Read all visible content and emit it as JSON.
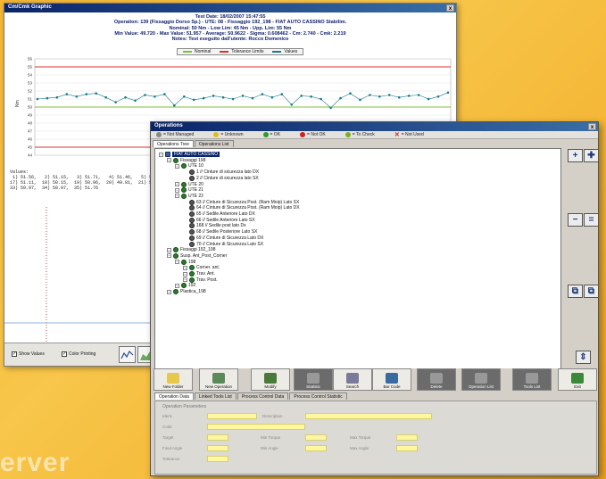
{
  "graph_window": {
    "title": "Cm/Cmk Graphic",
    "close": "x",
    "header_lines": [
      "Test Date: 18/02/2007 15:47:55",
      "Operation: 139 (Fissaggio Dorso Sp.)  -  UTE: 08  -  Fissaggio 192_198  -  FIAT AUTO CASSINO Stabilim.",
      "Nominal: 50 Nm  -  Low Lim: 45 Nm  -  Upp. Lim: 55 Nm",
      "Min Value: 49.720  -  Max Value: 51.957  -  Average: 50.9622  -  Sigma: 0.608462  -  Cm: 2.740  -  Cmk: 2.219",
      "Notes: Test eseguito dall'utente: Rocco Domenico"
    ],
    "legend": [
      "Nominal",
      "Tolerance Limits",
      "Values"
    ],
    "y_axis_label": "Nm",
    "values_label": "Values:",
    "values_lines": [
      " 1) 51.56,   2) 51.15,   3) 51.71,   4) 51.46,   5) 51.76,",
      "17) 51.11,  18) 50.15,  19) 50.96,  20) 49.81,  21) 51.14,",
      "33) 50.97,  34) 50.97,  35) 51.76"
    ],
    "footer": {
      "show_values": "Show Values",
      "color_printing": "Color Printing"
    }
  },
  "chart_data": {
    "type": "line",
    "title": "",
    "xlabel": "",
    "ylabel": "Nm",
    "ylim": [
      44,
      56
    ],
    "y_ticks": [
      56,
      55,
      54,
      53,
      52,
      51,
      50,
      49,
      48,
      47,
      46,
      45,
      44
    ],
    "nominal": 50,
    "tolerance_limits": [
      45,
      55
    ],
    "series": [
      {
        "name": "Values",
        "values": [
          51.0,
          51.1,
          51.2,
          51.6,
          51.3,
          51.6,
          51.7,
          51.2,
          50.6,
          51.2,
          50.8,
          51.5,
          51.3,
          51.6,
          50.2,
          51.3,
          50.9,
          51.1,
          51.4,
          51.2,
          51.0,
          51.4,
          51.1,
          51.6,
          51.2,
          51.6,
          50.3,
          51.4,
          51.3,
          51.0,
          49.9,
          51.1,
          51.7,
          50.9,
          51.5,
          51.3,
          51.5,
          51.2,
          51.4,
          51.5,
          51.0,
          51.3,
          51.8
        ]
      }
    ],
    "colors": {
      "nominal": "#7fc23a",
      "limits": "#e03030",
      "values": "#1a7a8a"
    }
  },
  "ops_window": {
    "title": "Operations",
    "close": "x",
    "legend": [
      {
        "label": "= Not Managed",
        "color": "#888888"
      },
      {
        "label": "= Unknown",
        "color": "#d8c020"
      },
      {
        "label": "= OK",
        "color": "#2c9a2c"
      },
      {
        "label": "= Not OK",
        "color": "#d02020"
      },
      {
        "label": "= To Check",
        "color": "#7ab020"
      },
      {
        "label": "= Not Used",
        "color": "#d02020"
      }
    ],
    "tabs": [
      "Operations Tree",
      "Operations List"
    ],
    "tree": [
      {
        "text": "FIAT AUTO CASSINO",
        "level": 0,
        "icon": "doc",
        "selected": true
      },
      {
        "text": "Fissaggi 198",
        "level": 1,
        "icon": "node"
      },
      {
        "text": "UTE 10",
        "level": 2,
        "icon": "node"
      },
      {
        "text": "1 // Cinture di sicurezza lato DX",
        "level": 3,
        "icon": "gear"
      },
      {
        "text": "2 // Cinture di sicurezza lato SX",
        "level": 3,
        "icon": "gear"
      },
      {
        "text": "UTE 20",
        "level": 2,
        "icon": "node"
      },
      {
        "text": "UTE 21",
        "level": 2,
        "icon": "node"
      },
      {
        "text": "UTE 22",
        "level": 2,
        "icon": "node"
      },
      {
        "text": "63 // Cinture di Sicurezza Post. (Ram Moip) Lato SX",
        "level": 3,
        "icon": "gear"
      },
      {
        "text": "64 // Cinture di Sicurezza Post. (Ram Moip) Lato DX",
        "level": 3,
        "icon": "gear"
      },
      {
        "text": "65 // Sedile Anteriore Lato DX",
        "level": 3,
        "icon": "gear"
      },
      {
        "text": "66 // Sedile Anteriore Lato SX",
        "level": 3,
        "icon": "gear"
      },
      {
        "text": "168 // Sedile post lato Dx",
        "level": 3,
        "icon": "gear"
      },
      {
        "text": "68 // Sedile Posteriore Lato SX",
        "level": 3,
        "icon": "gear"
      },
      {
        "text": "69 // Cinture di Sicurezza Lato DX",
        "level": 3,
        "icon": "gear"
      },
      {
        "text": "70 // Cinture di Sicurezza Lato SX",
        "level": 3,
        "icon": "gear"
      },
      {
        "text": "Fissaggi 192_198",
        "level": 1,
        "icon": "node"
      },
      {
        "text": "Susp. Ant_Post_Corner",
        "level": 1,
        "icon": "node"
      },
      {
        "text": "198",
        "level": 2,
        "icon": "node"
      },
      {
        "text": "Corner. ant.",
        "level": 3,
        "icon": "node"
      },
      {
        "text": "Trav. Ant.",
        "level": 3,
        "icon": "node"
      },
      {
        "text": "Trav. Post.",
        "level": 3,
        "icon": "node"
      },
      {
        "text": "192",
        "level": 2,
        "icon": "node"
      },
      {
        "text": "Plastica_198",
        "level": 1,
        "icon": "node"
      }
    ],
    "toolbar": [
      {
        "label": "New Folder",
        "dark": false
      },
      {
        "label": "New Operation",
        "dark": false
      },
      {
        "label": "Modify",
        "dark": false
      },
      {
        "label": "Statistic",
        "dark": true
      },
      {
        "label": "Search",
        "dark": false
      },
      {
        "label": "Bar Code",
        "dark": false
      },
      {
        "label": "Delete",
        "dark": true
      },
      {
        "label": "Operation List",
        "dark": true
      },
      {
        "label": "Tools List",
        "dark": true
      },
      {
        "label": "Exit",
        "dark": false
      }
    ],
    "bottom_tabs": [
      "Operation Data",
      "Linked Tools List",
      "Process Control Data",
      "Process Control Statistic"
    ],
    "params_title": "Operation Parameters",
    "param_labels": {
      "ident": "Ident.",
      "code": "Code",
      "target": "Target",
      "min_torque": "Min Torque",
      "max_torque": "Max Torque",
      "min_angle": "Min Angle",
      "max_angle": "Max Angle",
      "final_angle": "Final Angle",
      "tolerance": "Tolerance",
      "description": "Description"
    }
  }
}
